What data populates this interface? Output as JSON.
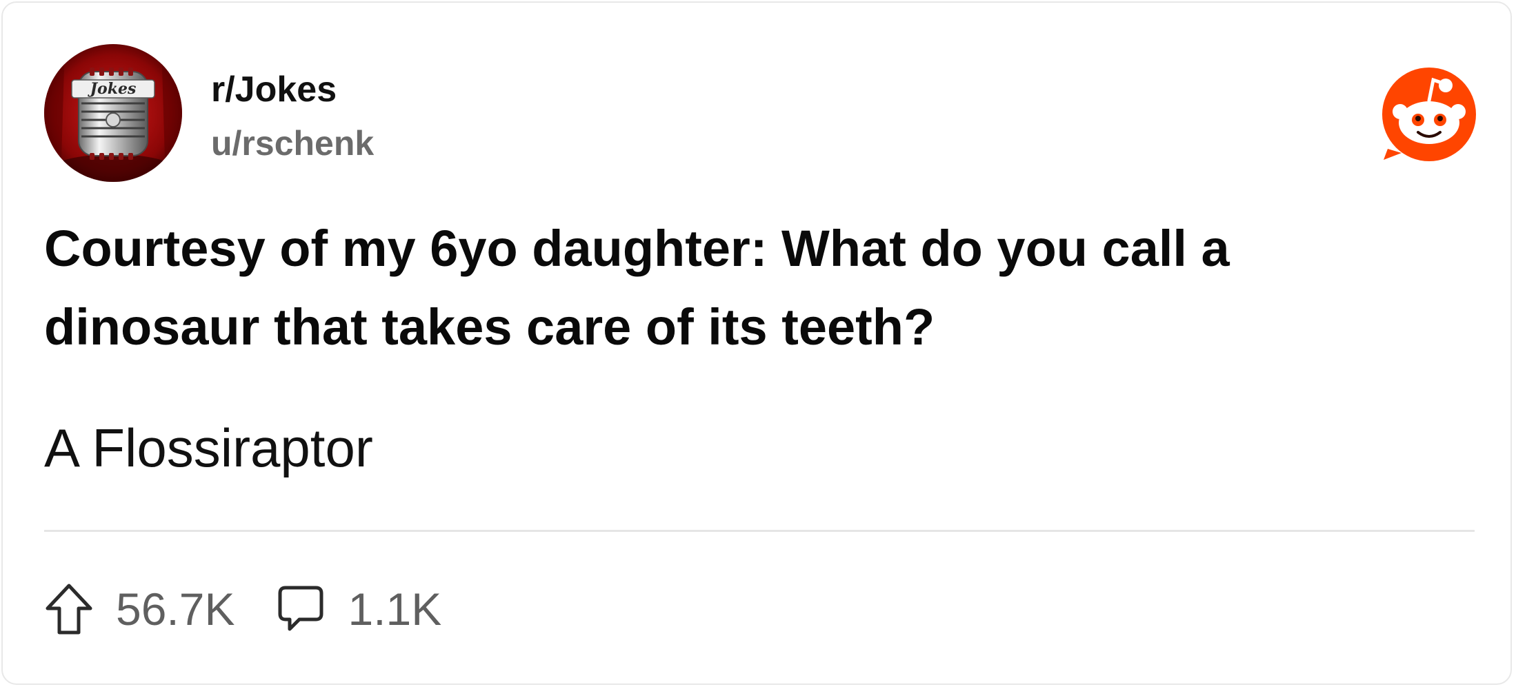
{
  "post": {
    "subreddit": "r/Jokes",
    "author": "u/rschenk",
    "title": "Courtesy of my 6yo daughter: What do you call a dinosaur that takes care of its teeth?",
    "body": "A Flossiraptor"
  },
  "avatar": {
    "icon": "microphone-icon",
    "text": "Jokes"
  },
  "brand": {
    "icon": "reddit-logo-icon",
    "color": "#ff4500"
  },
  "stats": {
    "upvotes": "56.7K",
    "comments": "1.1K",
    "upvote_icon": "upvote-arrow-icon",
    "comment_icon": "comment-bubble-icon"
  },
  "colors": {
    "title": "#0a0a0a",
    "author": "#6b6b6b",
    "stat_text": "#5f5f5f",
    "divider": "#e5e5e5",
    "avatar_bg": "#9a0c0c"
  }
}
